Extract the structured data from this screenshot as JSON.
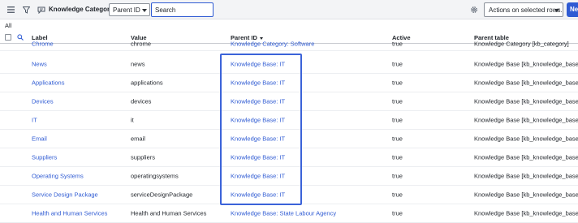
{
  "toolbar": {
    "title": "Knowledge Categories",
    "field_select": "Parent ID",
    "search_placeholder": "Search",
    "actions_select": "Actions on selected rows...",
    "new_button": "New"
  },
  "breadcrumb": "All",
  "columns": {
    "label": "Label",
    "value": "Value",
    "parent_id": "Parent ID",
    "active": "Active",
    "parent_table": "Parent table"
  },
  "rows": [
    {
      "label": "Chrome",
      "value": "chrome",
      "parent_id": "Knowledge Category: Software",
      "active": "true",
      "parent_table": "Knowledge Category [kb_category]"
    },
    {
      "label": "News",
      "value": "news",
      "parent_id": "Knowledge Base: IT",
      "active": "true",
      "parent_table": "Knowledge Base [kb_knowledge_base]"
    },
    {
      "label": "Applications",
      "value": "applications",
      "parent_id": "Knowledge Base: IT",
      "active": "true",
      "parent_table": "Knowledge Base [kb_knowledge_base]"
    },
    {
      "label": "Devices",
      "value": "devices",
      "parent_id": "Knowledge Base: IT",
      "active": "true",
      "parent_table": "Knowledge Base [kb_knowledge_base]"
    },
    {
      "label": "IT",
      "value": "it",
      "parent_id": "Knowledge Base: IT",
      "active": "true",
      "parent_table": "Knowledge Base [kb_knowledge_base]"
    },
    {
      "label": "Email",
      "value": "email",
      "parent_id": "Knowledge Base: IT",
      "active": "true",
      "parent_table": "Knowledge Base [kb_knowledge_base]"
    },
    {
      "label": "Suppliers",
      "value": "suppliers",
      "parent_id": "Knowledge Base: IT",
      "active": "true",
      "parent_table": "Knowledge Base [kb_knowledge_base]"
    },
    {
      "label": "Operating Systems",
      "value": "operatingsystems",
      "parent_id": "Knowledge Base: IT",
      "active": "true",
      "parent_table": "Knowledge Base [kb_knowledge_base]"
    },
    {
      "label": "Service Design Package",
      "value": "serviceDesignPackage",
      "parent_id": "Knowledge Base: IT",
      "active": "true",
      "parent_table": "Knowledge Base [kb_knowledge_base]"
    },
    {
      "label": "Health and Human Services",
      "value": "Health and Human Services",
      "parent_id": "Knowledge Base: State Labour Agency",
      "active": "true",
      "parent_table": "Knowledge Base [kb_knowledge_base]"
    }
  ],
  "icons": {
    "menu": "hamburger-icon",
    "filter": "filter-icon",
    "chat": "chat-icon",
    "settings": "gear-icon",
    "column_search": "search-icon"
  },
  "colors": {
    "accent": "#2f5bd3",
    "highlight_box": "#3b63d9"
  }
}
